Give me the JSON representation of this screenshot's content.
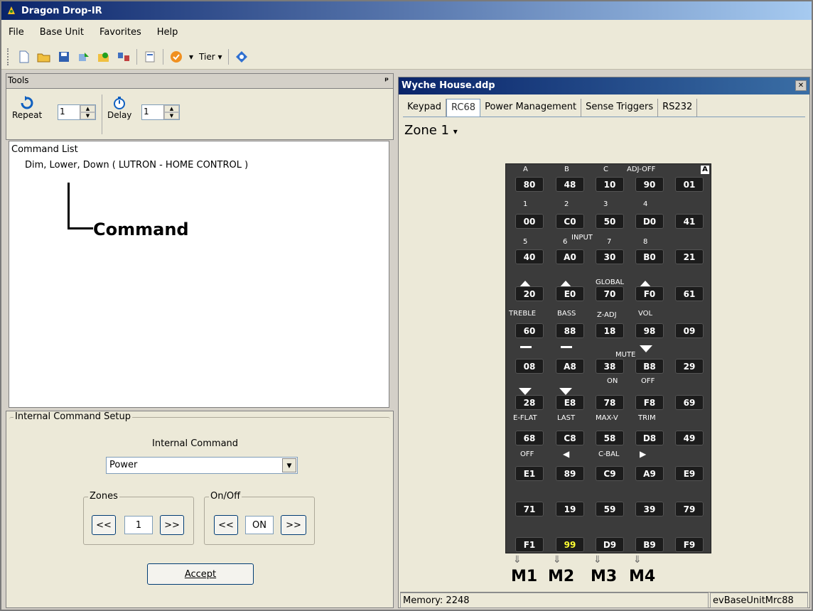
{
  "app": {
    "title": "Dragon Drop-IR"
  },
  "menu": [
    "File",
    "Base Unit",
    "Favorites",
    "Help"
  ],
  "toolbar": {
    "tier_label": "Tier"
  },
  "tools": {
    "header": "Tools",
    "repeat_label": "Repeat",
    "repeat_value": "1",
    "delay_label": "Delay",
    "delay_value": "1"
  },
  "command_list": {
    "header": "Command List",
    "item": "Dim, Lower, Down ( LUTRON - HOME CONTROL )",
    "annotation": "Command"
  },
  "setup": {
    "title": "Internal Command Setup",
    "command_label": "Internal Command",
    "command_value": "Power",
    "zones_label": "Zones",
    "zones_value": "1",
    "onoff_label": "On/Off",
    "onoff_value": "ON",
    "prev": "<<",
    "next": ">>",
    "accept": "Accept"
  },
  "document": {
    "title": "Wyche House.ddp",
    "tabs": [
      "Keypad",
      "RC68",
      "Power Management",
      "Sense Triggers",
      "RS232"
    ],
    "active_tab": "RC68",
    "zone": "Zone 1"
  },
  "remote": {
    "corner": "A",
    "buttons": [
      [
        "80",
        "48",
        "10",
        "90",
        "01"
      ],
      [
        "00",
        "C0",
        "50",
        "D0",
        "41"
      ],
      [
        "40",
        "A0",
        "30",
        "B0",
        "21"
      ],
      [
        "20",
        "E0",
        "70",
        "F0",
        "61"
      ],
      [
        "60",
        "88",
        "18",
        "98",
        "09"
      ],
      [
        "08",
        "A8",
        "38",
        "B8",
        "29"
      ],
      [
        "28",
        "E8",
        "78",
        "F8",
        "69"
      ],
      [
        "68",
        "C8",
        "58",
        "D8",
        "49"
      ],
      [
        "E1",
        "89",
        "C9",
        "A9",
        "E9"
      ],
      [
        "71",
        "19",
        "59",
        "39",
        "79"
      ],
      [
        "F1",
        "99",
        "D9",
        "B9",
        "F9"
      ]
    ],
    "labels": {
      "a": "A",
      "b": "B",
      "c": "C",
      "adjoff": "ADJ-OFF",
      "n1": "1",
      "n2": "2",
      "n3": "3",
      "n4": "4",
      "n5": "5",
      "n6": "6",
      "input": "INPUT",
      "n7": "7",
      "n8": "8",
      "global": "GLOBAL",
      "treble": "TREBLE",
      "bass": "BASS",
      "zadj": "Z-ADJ",
      "vol": "VOL",
      "mute": "MUTE",
      "on": "ON",
      "off": "OFF",
      "eflat": "E-FLAT",
      "last": "LAST",
      "maxv": "MAX-V",
      "trim": "TRIM",
      "off2": "OFF",
      "cbal": "C-BAL"
    },
    "macros": [
      "M1",
      "M2",
      "M3",
      "M4"
    ]
  },
  "status": {
    "memory": "Memory: 2248",
    "unit": "evBaseUnitMrc88"
  },
  "colors": {
    "title_start": "#0a246a",
    "title_end": "#a6caf0",
    "remote_bg": "#3b3b3b",
    "highlight": "#ffff33"
  }
}
